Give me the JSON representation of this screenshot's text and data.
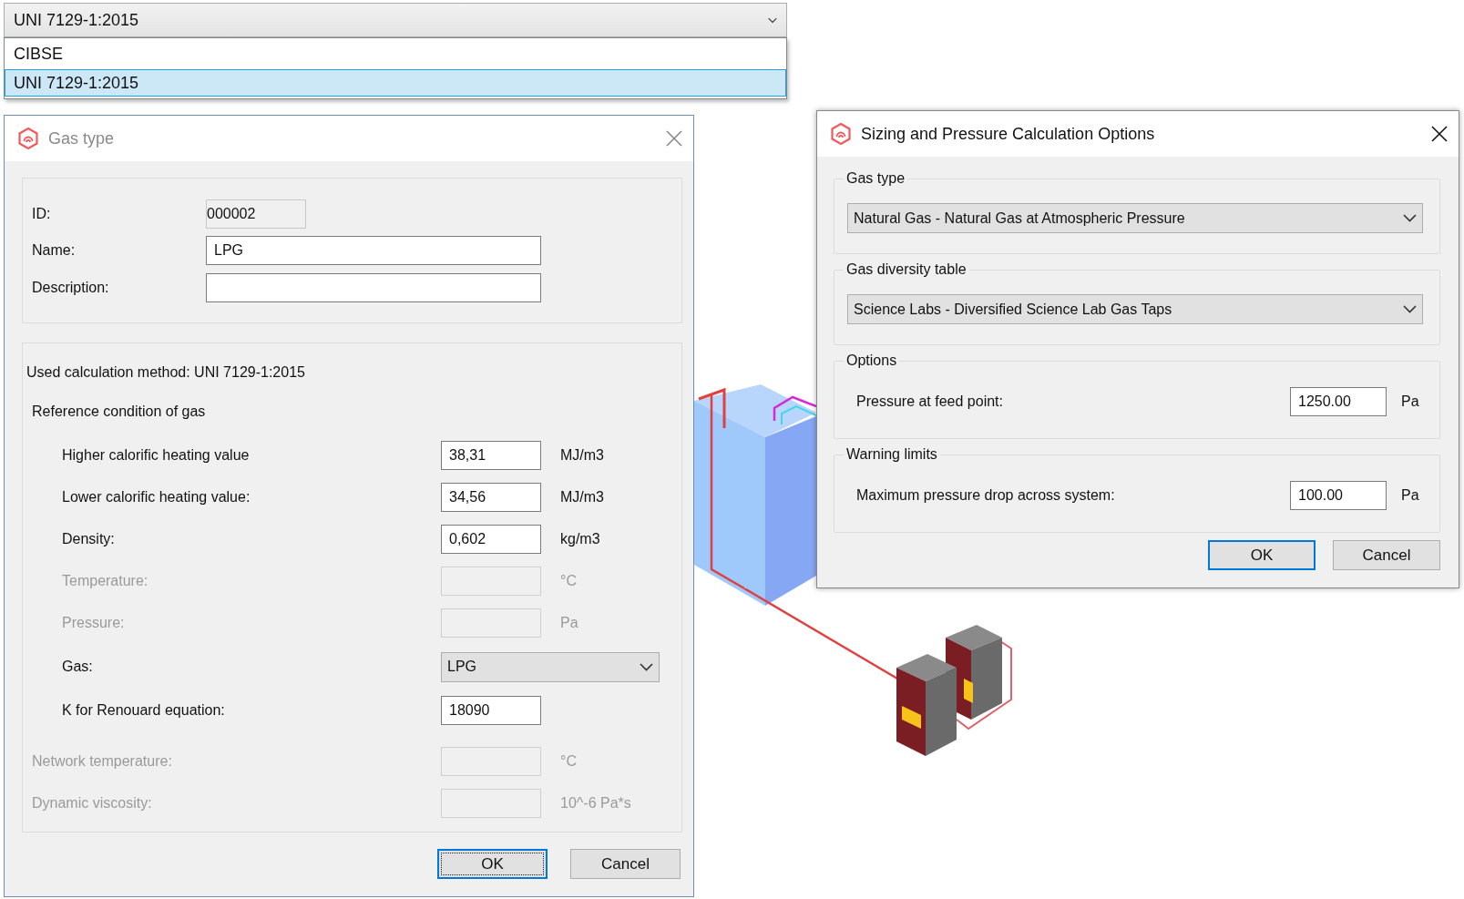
{
  "standard_dropdown": {
    "value": "UNI 7129-1:2015",
    "options": [
      {
        "label": "CIBSE",
        "selected": false
      },
      {
        "label": "UNI 7129-1:2015",
        "selected": true
      }
    ]
  },
  "gas_type_dialog": {
    "title": "Gas type",
    "active": false,
    "fields": [
      {
        "label": "ID:",
        "value": "000002",
        "kind": "readonly"
      },
      {
        "label": "Name:",
        "value": "LPG",
        "kind": "text"
      },
      {
        "label": "Description:",
        "kind": "text"
      }
    ],
    "method": "Used calculation method: UNI 7129-1:2015",
    "reference_heading": "Reference condition of gas",
    "reference_rows": [
      {
        "label": "Higher calorific heating value",
        "value": "38,31",
        "unit": "MJ/m3",
        "kind": "input",
        "disabled": false
      },
      {
        "label": "Lower calorific heating value:",
        "value": "34,56",
        "unit": "MJ/m3",
        "kind": "input",
        "disabled": false
      },
      {
        "label": "Density:",
        "value": "0,602",
        "unit": "kg/m3",
        "kind": "input",
        "disabled": false
      },
      {
        "label": "Temperature:",
        "unit": "°C",
        "kind": "input",
        "disabled": true
      },
      {
        "label": "Pressure:",
        "unit": "Pa",
        "kind": "input",
        "disabled": true
      },
      {
        "label": "Gas:",
        "value": "LPG",
        "kind": "select",
        "disabled": false
      },
      {
        "label": "K for Renouard equation:",
        "value": "18090",
        "kind": "input",
        "disabled": false
      }
    ],
    "network_rows": [
      {
        "label": "Network temperature:",
        "unit": "°C",
        "kind": "input",
        "disabled": true
      },
      {
        "label": "Dynamic viscosity:",
        "unit": "10^-6 Pa*s",
        "kind": "input",
        "disabled": true
      }
    ],
    "buttons": [
      {
        "label": "OK",
        "default": true
      },
      {
        "label": "Cancel",
        "default": false
      }
    ]
  },
  "sizing_dialog": {
    "title": "Sizing and Pressure Calculation Options",
    "active": true,
    "groups": [
      {
        "title": "Gas type",
        "kind": "select",
        "value": "Natural Gas - Natural Gas at Atmospheric Pressure"
      },
      {
        "title": "Gas diversity table",
        "kind": "select",
        "value": "Science Labs - Diversified Science Lab Gas Taps"
      },
      {
        "title": "Options",
        "kind": "input",
        "label": "Pressure at feed point:",
        "value": "1250.00",
        "unit": "Pa"
      },
      {
        "title": "Warning limits",
        "kind": "input",
        "label": "Maximum pressure drop across system:",
        "value": "100.00",
        "unit": "Pa"
      }
    ],
    "buttons": [
      {
        "label": "OK",
        "default": true
      },
      {
        "label": "Cancel",
        "default": false
      }
    ]
  }
}
